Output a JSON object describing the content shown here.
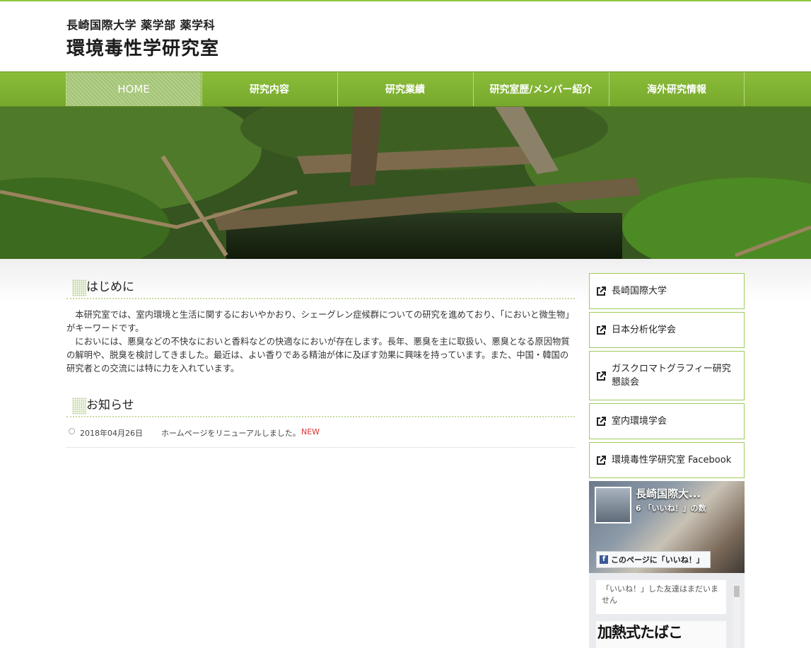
{
  "header": {
    "subtitle": "長崎国際大学 薬学部 薬学科",
    "title": "環境毒性学研究室"
  },
  "nav": {
    "items": [
      {
        "label": "HOME"
      },
      {
        "label": "研究内容"
      },
      {
        "label": "研究業績"
      },
      {
        "label": "研究室歴/メンバー紹介"
      },
      {
        "label": "海外研究情報"
      }
    ],
    "active_index": 0
  },
  "main": {
    "intro": {
      "heading": "はじめに",
      "paragraphs": [
        "本研究室では、室内環境と生活に関するにおいやかおり、シェーグレン症候群についての研究を進めており、「においと微生物」がキーワードです。",
        "においには、悪臭などの不快なにおいと香料などの快適なにおいが存在します。長年、悪臭を主に取扱い、悪臭となる原因物質の解明や、脱臭を検討してきました。最近は、よい香りである精油が体に及ぼす効果に興味を持っています。また、中国・韓国の研究者との交流には特に力を入れています。"
      ]
    },
    "news": {
      "heading": "お知らせ",
      "items": [
        {
          "date": "2018年04月26日",
          "text": "ホームページをリニューアルしました。",
          "badge": "NEW"
        }
      ]
    }
  },
  "sidebar": {
    "links": [
      {
        "label": "長崎国際大学"
      },
      {
        "label": "日本分析化学会"
      },
      {
        "label": "ガスクロマトグラフィー研究懇談会"
      },
      {
        "label": "室内環境学会"
      },
      {
        "label": "環境毒性学研究室 Facebook"
      }
    ],
    "facebook": {
      "page_name": "長崎国際大...",
      "like_count": "6 「いいね！」の数",
      "like_button": "このページに「いいね！」",
      "friends_message": "「いいね！」した友達はまだいません",
      "post_headline": "加熱式たばこ"
    }
  },
  "colors": {
    "accent_green": "#8cc63f",
    "nav_green": "#7fb033",
    "link_border": "#9ccc5a",
    "new_badge": "#e03030",
    "facebook_blue": "#3b5998"
  }
}
